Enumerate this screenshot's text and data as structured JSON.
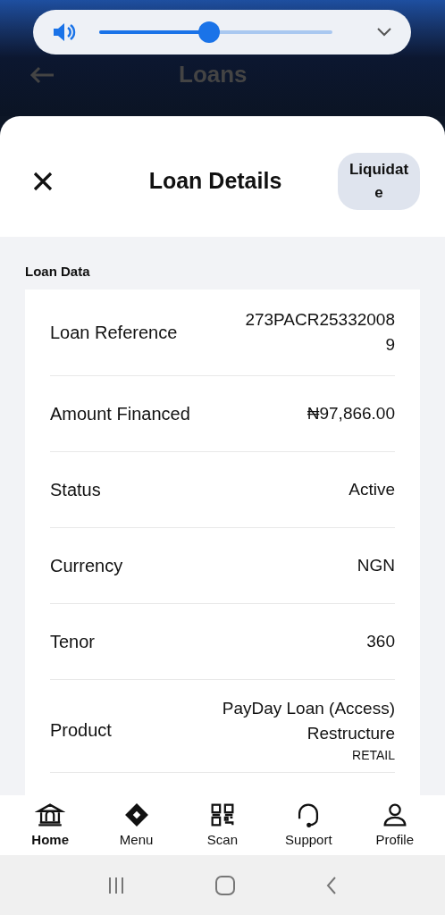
{
  "volume": {
    "level": 0.47
  },
  "background_header": {
    "title": "Loans"
  },
  "sheet": {
    "title": "Loan Details",
    "action": "Liquidate"
  },
  "section": {
    "title": "Loan Data"
  },
  "rows": [
    {
      "label": "Loan Reference",
      "value": "273PACR253320089"
    },
    {
      "label": "Amount Financed",
      "value": "₦97,866.00"
    },
    {
      "label": "Status",
      "value": "Active"
    },
    {
      "label": "Currency",
      "value": "NGN"
    },
    {
      "label": "Tenor",
      "value": "360"
    },
    {
      "label": "Product",
      "value": "PayDay Loan (Access) Restructure",
      "subvalue": "RETAIL"
    }
  ],
  "bottom_nav": [
    {
      "label": "Home",
      "kind": "bank",
      "selected": true
    },
    {
      "label": "Menu",
      "kind": "diamond",
      "selected": false
    },
    {
      "label": "Scan",
      "kind": "qr",
      "selected": false
    },
    {
      "label": "Support",
      "kind": "headset",
      "selected": false
    },
    {
      "label": "Profile",
      "kind": "user",
      "selected": false
    }
  ]
}
